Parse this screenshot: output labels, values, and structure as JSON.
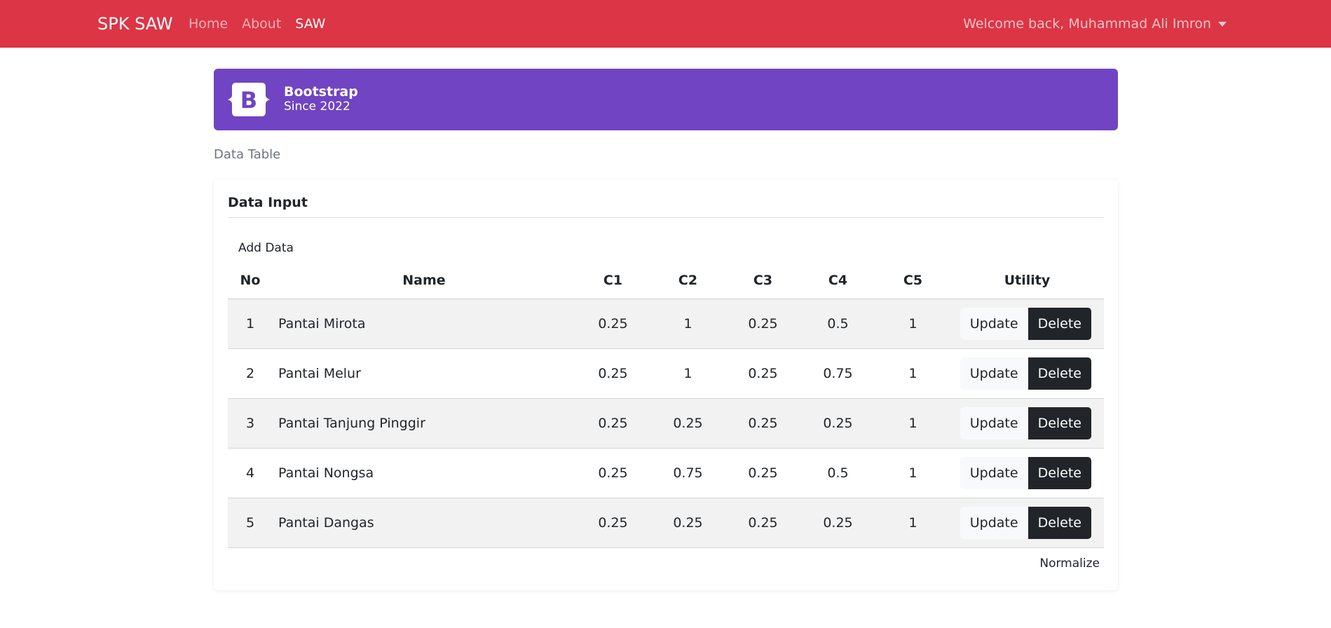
{
  "navbar": {
    "brand": "SPK SAW",
    "links": [
      {
        "label": "Home",
        "active": false
      },
      {
        "label": "About",
        "active": false
      },
      {
        "label": "SAW",
        "active": true
      }
    ],
    "user": "Welcome back, Muhammad Ali Imron",
    "color": "#dc3545"
  },
  "banner": {
    "logo_letter": "B",
    "title": "Bootstrap",
    "subtitle": "Since 2022",
    "color": "#7044c2"
  },
  "section_label": "Data Table",
  "card": {
    "title": "Data Input",
    "add_label": "Add Data",
    "normalize_label": "Normalize"
  },
  "table": {
    "headers": [
      "No",
      "Name",
      "C1",
      "C2",
      "C3",
      "C4",
      "C5",
      "Utility"
    ],
    "update_label": "Update",
    "delete_label": "Delete",
    "rows": [
      {
        "no": "1",
        "name": "Pantai Mirota",
        "c1": "0.25",
        "c2": "1",
        "c3": "0.25",
        "c4": "0.5",
        "c5": "1"
      },
      {
        "no": "2",
        "name": "Pantai Melur",
        "c1": "0.25",
        "c2": "1",
        "c3": "0.25",
        "c4": "0.75",
        "c5": "1"
      },
      {
        "no": "3",
        "name": "Pantai Tanjung Pinggir",
        "c1": "0.25",
        "c2": "0.25",
        "c3": "0.25",
        "c4": "0.25",
        "c5": "1"
      },
      {
        "no": "4",
        "name": "Pantai Nongsa",
        "c1": "0.25",
        "c2": "0.75",
        "c3": "0.25",
        "c4": "0.5",
        "c5": "1"
      },
      {
        "no": "5",
        "name": "Pantai Dangas",
        "c1": "0.25",
        "c2": "0.25",
        "c3": "0.25",
        "c4": "0.25",
        "c5": "1"
      }
    ]
  }
}
